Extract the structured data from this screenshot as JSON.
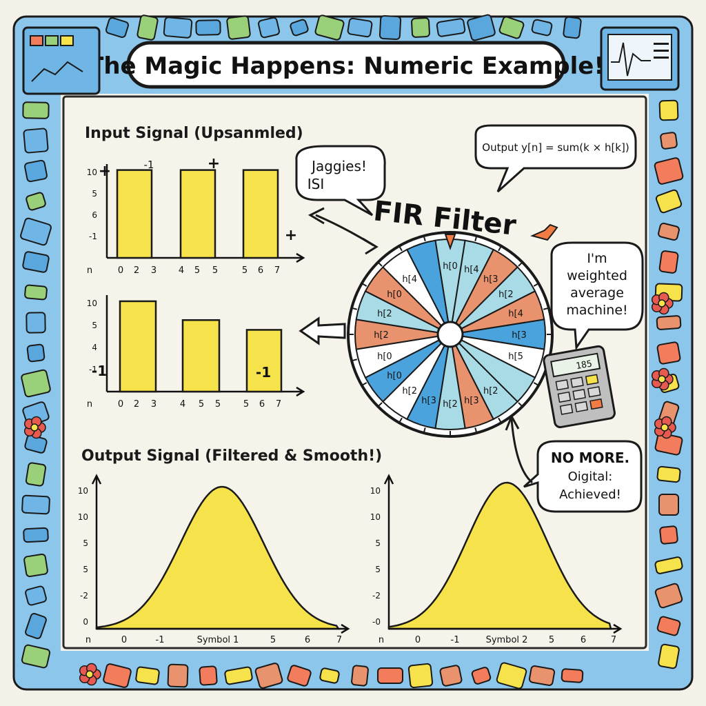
{
  "title": "The Magic Happens: Numeric Example!",
  "colors": {
    "bar_fill": "#f6e24a",
    "wheel_orange": "#e8936e",
    "wheel_light_blue": "#a8dbe6",
    "wheel_blue": "#4aa3dc",
    "wheel_white": "#ffffff",
    "frame_blue": "#5aa7dd",
    "background": "#f4f1e8"
  },
  "input_section": {
    "heading": "Input Signal (Upsanmled)"
  },
  "output_section": {
    "heading": "Output Signal (Filtered & Smooth!)"
  },
  "bubbles": {
    "jaggies": "Jaggies!",
    "isi": "ISI",
    "output_formula": "Output y[n] = sum(k × h[k])",
    "weighted_1": "I'm",
    "weighted_2": "weighted",
    "weighted_3": "average",
    "weighted_4": "machine!",
    "nomore_1": "NO MORE.",
    "nomore_2": "Oigital:",
    "nomore_3": "Achieved!"
  },
  "fir_label": "FIR Filter",
  "calculator_display": "185",
  "wheel": {
    "segments": [
      {
        "label": "h[0",
        "color": "light_blue"
      },
      {
        "label": "h[4",
        "color": "light_blue"
      },
      {
        "label": "h[3",
        "color": "orange"
      },
      {
        "label": "h[2",
        "color": "light_blue"
      },
      {
        "label": "h[4",
        "color": "orange"
      },
      {
        "label": "h[3",
        "color": "blue"
      },
      {
        "label": "h[5",
        "color": "white"
      },
      {
        "label": "",
        "color": "light_blue"
      },
      {
        "label": "h[2",
        "color": "light_blue"
      },
      {
        "label": "h[3",
        "color": "orange"
      },
      {
        "label": "h[2",
        "color": "light_blue"
      },
      {
        "label": "h[3",
        "color": "blue"
      },
      {
        "label": "h[2",
        "color": "white"
      },
      {
        "label": "h[0",
        "color": "blue"
      },
      {
        "label": "h[0",
        "color": "white"
      },
      {
        "label": "h[2",
        "color": "orange"
      },
      {
        "label": "h[2",
        "color": "light_blue"
      },
      {
        "label": "h[0",
        "color": "orange"
      },
      {
        "label": "h[4",
        "color": "white"
      },
      {
        "label": "",
        "color": "blue"
      }
    ]
  },
  "chart_data": [
    {
      "type": "bar",
      "title": "Input Signal (Upsanmled)",
      "ytick_labels": [
        "10",
        "5",
        "6",
        "-1"
      ],
      "xtick_labels": [
        "n",
        "0",
        "2",
        "3",
        "4",
        "5",
        "5",
        "5",
        "6",
        "7"
      ],
      "bar_values": [
        10,
        10,
        10
      ],
      "ylim": [
        -2,
        11
      ],
      "annotations": [
        "+",
        "-1",
        "+",
        "+"
      ]
    },
    {
      "type": "bar",
      "ytick_labels": [
        "10",
        "5",
        "4",
        "-1"
      ],
      "xtick_labels": [
        "n",
        "0",
        "2",
        "3",
        "4",
        "5",
        "5",
        "5",
        "6",
        "7"
      ],
      "bar_values": [
        10,
        7.5,
        6.2
      ],
      "ylim": [
        -2,
        11
      ],
      "annotations": [
        "-1",
        "-1"
      ]
    },
    {
      "type": "area",
      "title": "Output Signal (Filtered & Smooth!)",
      "ytick_labels": [
        "10",
        "10",
        "5",
        "5",
        "-2",
        "0"
      ],
      "xtick_labels": [
        "n",
        "0",
        "-1",
        "Symbol 1",
        "5",
        "6",
        "7"
      ],
      "shape": "bell"
    },
    {
      "type": "area",
      "ytick_labels": [
        "10",
        "10",
        "5",
        "5",
        "-2",
        "-0"
      ],
      "xtick_labels": [
        "n",
        "0",
        "-1",
        "Symbol 2",
        "5",
        "6",
        "7"
      ],
      "shape": "bell"
    }
  ]
}
